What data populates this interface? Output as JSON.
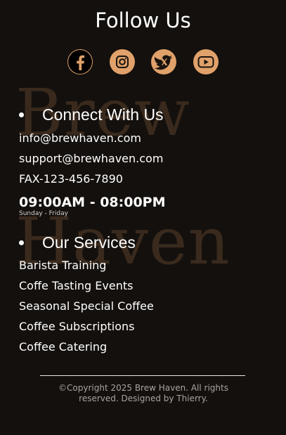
{
  "watermark": {
    "line1": "Brew",
    "line2": "Haven"
  },
  "follow": {
    "title": "Follow Us",
    "socials": [
      {
        "icon": "facebook-icon",
        "label": "Facebook"
      },
      {
        "icon": "instagram-icon",
        "label": "Instagram"
      },
      {
        "icon": "twitter-icon",
        "label": "Twitter"
      },
      {
        "icon": "youtube-icon",
        "label": "YouTube"
      }
    ]
  },
  "connect": {
    "heading": "Connect With Us",
    "email1": "info@brewhaven.com",
    "email2": "support@brewhaven.com",
    "fax": "FAX-123-456-7890",
    "hours": "09:00AM - 08:00PM",
    "days": "Sunday - Friday"
  },
  "services": {
    "heading": "Our Services",
    "items": [
      "Barista Training",
      "Coffe Tasting Events",
      "Seasonal Special Coffee",
      "Coffee Subscriptions",
      "Coffee Catering"
    ]
  },
  "footer": {
    "copyright": "©Copyright 2025 Brew Haven. All rights reserved. Designed by Thierry."
  },
  "colors": {
    "background": "#14100d",
    "accent": "#e0a16a",
    "watermark": "#3a2a1d",
    "text": "#ffffff",
    "muted": "#a8a49f"
  }
}
